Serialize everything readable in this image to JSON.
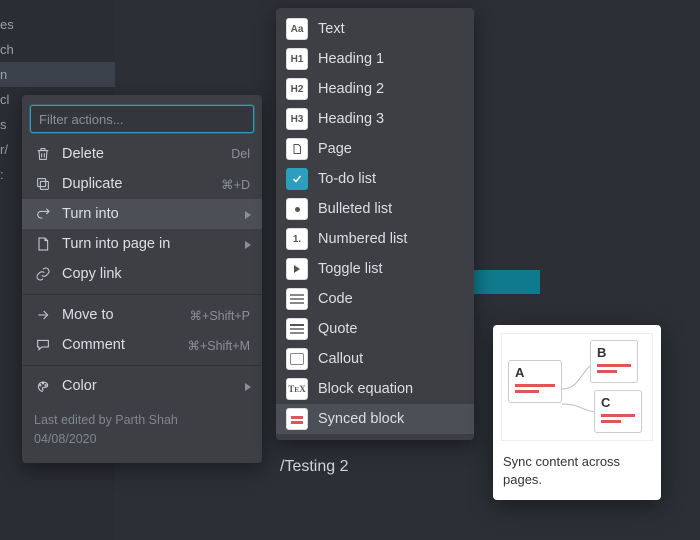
{
  "sidebar_hints": [
    "es",
    "ch",
    "n",
    "cl",
    "s",
    "r/",
    ":"
  ],
  "page": {
    "slash_text": "/Testing 2"
  },
  "menu1": {
    "filter_placeholder": "Filter actions...",
    "items": [
      {
        "label": "Delete",
        "shortcut": "Del",
        "icon": "trash-icon",
        "submenu": false
      },
      {
        "label": "Duplicate",
        "shortcut": "⌘+D",
        "icon": "duplicate-icon",
        "submenu": false
      },
      {
        "label": "Turn into",
        "shortcut": "",
        "icon": "turninto-icon",
        "submenu": true,
        "hl": true
      },
      {
        "label": "Turn into page in",
        "shortcut": "",
        "icon": "page-icon",
        "submenu": true
      },
      {
        "label": "Copy link",
        "shortcut": "",
        "icon": "link-icon",
        "submenu": false
      }
    ],
    "items2": [
      {
        "label": "Move to",
        "shortcut": "⌘+Shift+P",
        "icon": "moveto-icon",
        "submenu": true
      },
      {
        "label": "Comment",
        "shortcut": "⌘+Shift+M",
        "icon": "comment-icon",
        "submenu": false
      }
    ],
    "items3": [
      {
        "label": "Color",
        "shortcut": "",
        "icon": "color-icon",
        "submenu": true
      }
    ],
    "footer_line1": "Last edited by Parth Shah",
    "footer_line2": "04/08/2020"
  },
  "menu2": {
    "items": [
      {
        "label": "Text",
        "thumb": "Aa"
      },
      {
        "label": "Heading 1",
        "thumb": "H1"
      },
      {
        "label": "Heading 2",
        "thumb": "H2"
      },
      {
        "label": "Heading 3",
        "thumb": "H3"
      },
      {
        "label": "Page",
        "thumb": "pg"
      },
      {
        "label": "To-do list",
        "thumb": "chk"
      },
      {
        "label": "Bulleted list",
        "thumb": "dot"
      },
      {
        "label": "Numbered list",
        "thumb": "1."
      },
      {
        "label": "Toggle list",
        "thumb": "tri"
      },
      {
        "label": "Code",
        "thumb": "code"
      },
      {
        "label": "Quote",
        "thumb": "quote"
      },
      {
        "label": "Callout",
        "thumb": "callout"
      },
      {
        "label": "Block equation",
        "thumb": "tex"
      },
      {
        "label": "Synced block",
        "thumb": "sync",
        "hl": true
      }
    ]
  },
  "tooltip": {
    "description": "Sync content across pages.",
    "cards": {
      "a": "A",
      "b": "B",
      "c": "C"
    }
  }
}
